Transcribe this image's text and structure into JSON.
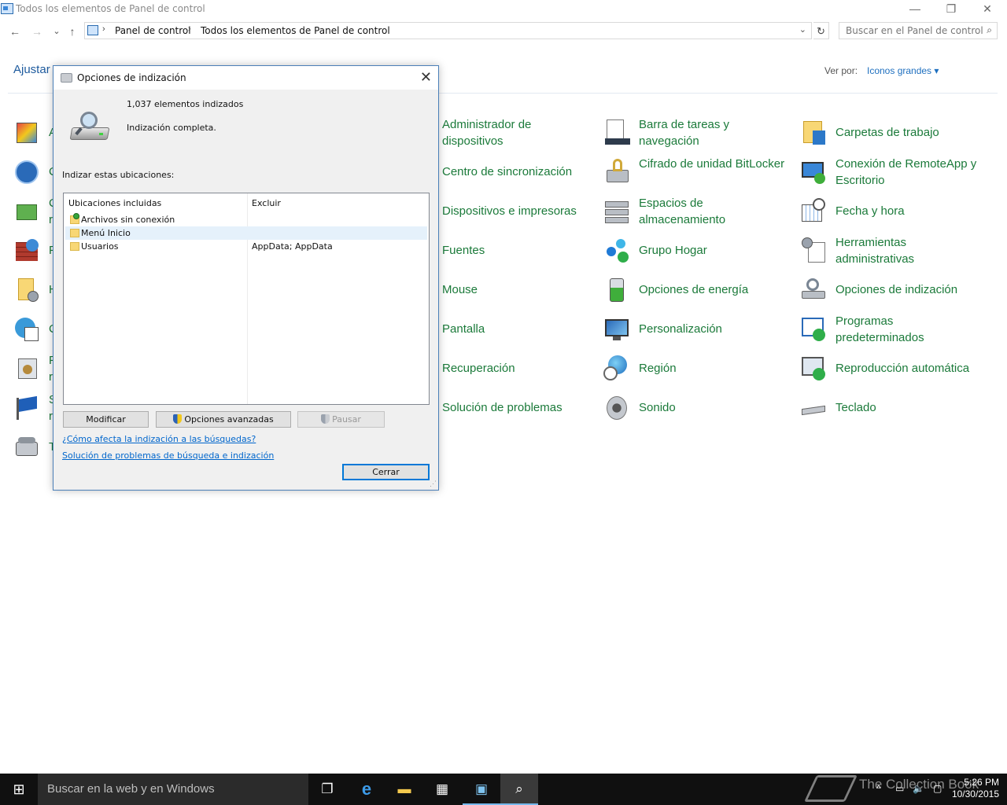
{
  "window": {
    "title": "Todos los elementos de Panel de control",
    "minimize": "—",
    "maximize": "❐",
    "close": "✕"
  },
  "nav": {
    "back": "←",
    "forward": "→",
    "recent": "⌄",
    "up": "↑",
    "breadcrumb": [
      "Panel de control",
      "Todos los elementos de Panel de control"
    ],
    "separator": "›",
    "dropdown": "⌄",
    "refresh": "↻",
    "search_placeholder": "Buscar en el Panel de control",
    "search_icon": "⌕"
  },
  "content": {
    "heading": "Ajustar",
    "view_by_label": "Ver por:",
    "view_by_value": "Iconos grandes ▾"
  },
  "items": {
    "col1": {
      "i0": "Administrador de dispositivos",
      "i1": "Centro de sincronización",
      "i2": "Dispositivos e impresoras",
      "i3": "Fuentes",
      "i4": "Mouse",
      "i5": "Pantalla",
      "i6": "Recuperación",
      "i7": "Solución de problemas"
    },
    "col2": {
      "i0": "Barra de tareas y navegación",
      "i1": "Cifrado de unidad BitLocker",
      "i2": "Espacios de almacenamiento",
      "i3": "Grupo Hogar",
      "i4": "Opciones de energía",
      "i5": "Personalización",
      "i6": "Región",
      "i7": "Sonido"
    },
    "col3": {
      "i0": "Carpetas de trabajo",
      "i1": "Conexión de RemoteApp y Escritorio",
      "i2": "Fecha y hora",
      "i3": "Herramientas administrativas",
      "i4": "Opciones de indización",
      "i5": "Programas predeterminados",
      "i6": "Reproducción automática",
      "i7": "Teclado"
    },
    "left_partial": {
      "p0": "A",
      "p1": "C",
      "p2": "C",
      "p2b": "r",
      "p3": "F",
      "p4": "H",
      "p5": "C",
      "p6": "P",
      "p6b": "r",
      "p7": "S",
      "p7b": "r",
      "p8": "T"
    }
  },
  "dialog": {
    "title": "Opciones de indización",
    "close": "✕",
    "count": "1,037 elementos indizados",
    "status": "Indización completa.",
    "section_label": "Indizar estas ubicaciones:",
    "col_included": "Ubicaciones incluidas",
    "col_exclude": "Excluir",
    "rows": [
      {
        "name": "Archivos sin conexión",
        "exclude": ""
      },
      {
        "name": "Menú Inicio",
        "exclude": ""
      },
      {
        "name": "Usuarios",
        "exclude": "AppData; AppData"
      }
    ],
    "btn_modify": "Modificar",
    "btn_advanced": "Opciones avanzadas",
    "btn_pause": "Pausar",
    "link_how": "¿Cómo afecta la indización a las búsquedas?",
    "link_troubleshoot": "Solución de problemas de búsqueda e indización",
    "btn_close": "Cerrar"
  },
  "taskbar": {
    "start": "⊞",
    "search_placeholder": "Buscar en la web y en Windows",
    "task_view": "❐",
    "edge": "e",
    "explorer": "▬",
    "store": "▦",
    "control_panel": "▣",
    "indexing": "⌕",
    "tray_chevron": "^",
    "network": "▭",
    "volume": "🔈",
    "notifications": "▢",
    "time": "5:26 PM",
    "date": "10/30/2015",
    "watermark": "The Collection Book"
  },
  "colors": {
    "link_green": "#1b7a3a",
    "heading_blue": "#1e5b9e",
    "dialog_border": "#4b7fb8",
    "taskbar": "#101010"
  }
}
